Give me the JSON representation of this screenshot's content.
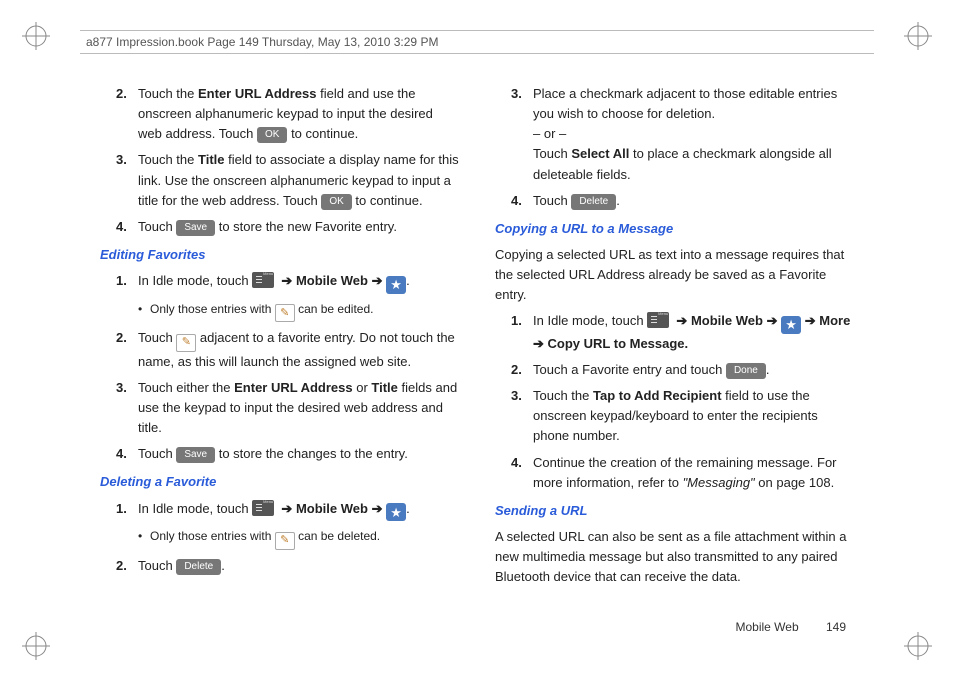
{
  "header": "a877 Impression.book  Page 149  Thursday, May 13, 2010  3:29 PM",
  "buttons": {
    "ok": "OK",
    "save": "Save",
    "delete": "Delete",
    "done": "Done"
  },
  "arrows": {
    "r": "➔"
  },
  "left": {
    "item2": {
      "n": "2.",
      "pre": "Touch the ",
      "b1": "Enter URL Address",
      "mid": " field and use the onscreen alphanumeric keypad to input the desired web address. Touch ",
      "post": " to continue."
    },
    "item3": {
      "n": "3.",
      "pre": "Touch the ",
      "b1": "Title",
      "mid": " field to associate a display name for this link. Use the onscreen alphanumeric keypad to input a title for the web address. Touch ",
      "post": " to continue."
    },
    "item4": {
      "n": "4.",
      "pre": "Touch ",
      "post": " to store the new Favorite entry."
    },
    "sub1": "Editing Favorites",
    "e1": {
      "n": "1.",
      "pre": "In Idle mode, touch ",
      "mid1": "  ",
      "b1": "Mobile Web",
      "mid2": " ",
      "post": "."
    },
    "e1b": {
      "pre": "Only those entries with ",
      "post": " can be edited."
    },
    "e2": {
      "n": "2.",
      "pre": "Touch ",
      "post": " adjacent to a favorite entry. Do not touch the name, as this will launch the assigned web site."
    },
    "e3": {
      "n": "3.",
      "pre": "Touch either the ",
      "b1": "Enter URL Address",
      "mid": " or ",
      "b2": "Title",
      "post": " fields and use the keypad to input the desired web address and title."
    },
    "e4": {
      "n": "4.",
      "pre": "Touch ",
      "post": " to store the changes to the entry."
    },
    "sub2": "Deleting a Favorite",
    "d1": {
      "n": "1.",
      "pre": "In Idle mode, touch ",
      "b1": "Mobile Web",
      "post": "."
    },
    "d1b": {
      "pre": "Only those entries with ",
      "post": " can be deleted."
    },
    "d2": {
      "n": "2.",
      "pre": "Touch ",
      "post": "."
    }
  },
  "right": {
    "r3": {
      "n": "3.",
      "l1": "Place a checkmark adjacent to those editable entries you wish to choose for deletion.",
      "or": "– or –",
      "l2a": "Touch ",
      "b1": "Select All",
      "l2b": " to place a checkmark alongside all deleteable fields."
    },
    "r4": {
      "n": "4.",
      "pre": "Touch ",
      "post": "."
    },
    "sub1": "Copying a URL to a Message",
    "p1": "Copying a selected URL as text into a message requires that the selected URL Address already be saved as a Favorite entry.",
    "c1": {
      "n": "1.",
      "pre": "In Idle mode, touch ",
      "b1": "Mobile Web",
      "b2": "More",
      "b3": "Copy URL to Message."
    },
    "c2": {
      "n": "2.",
      "pre": "Touch a Favorite entry and touch ",
      "post": "."
    },
    "c3": {
      "n": "3.",
      "pre": "Touch the ",
      "b1": "Tap to Add Recipient",
      "post": " field to use the onscreen keypad/keyboard to enter the recipients phone number."
    },
    "c4": {
      "n": "4.",
      "pre": "Continue the creation of the remaining message. For more information, refer to ",
      "ref": "\"Messaging\" ",
      "post": " on page 108."
    },
    "sub2": "Sending a URL",
    "p2": "A selected URL can also be sent as a file attachment within a new multimedia message but also transmitted to any paired Bluetooth device that can receive the data."
  },
  "footer": {
    "section": "Mobile Web",
    "page": "149"
  }
}
